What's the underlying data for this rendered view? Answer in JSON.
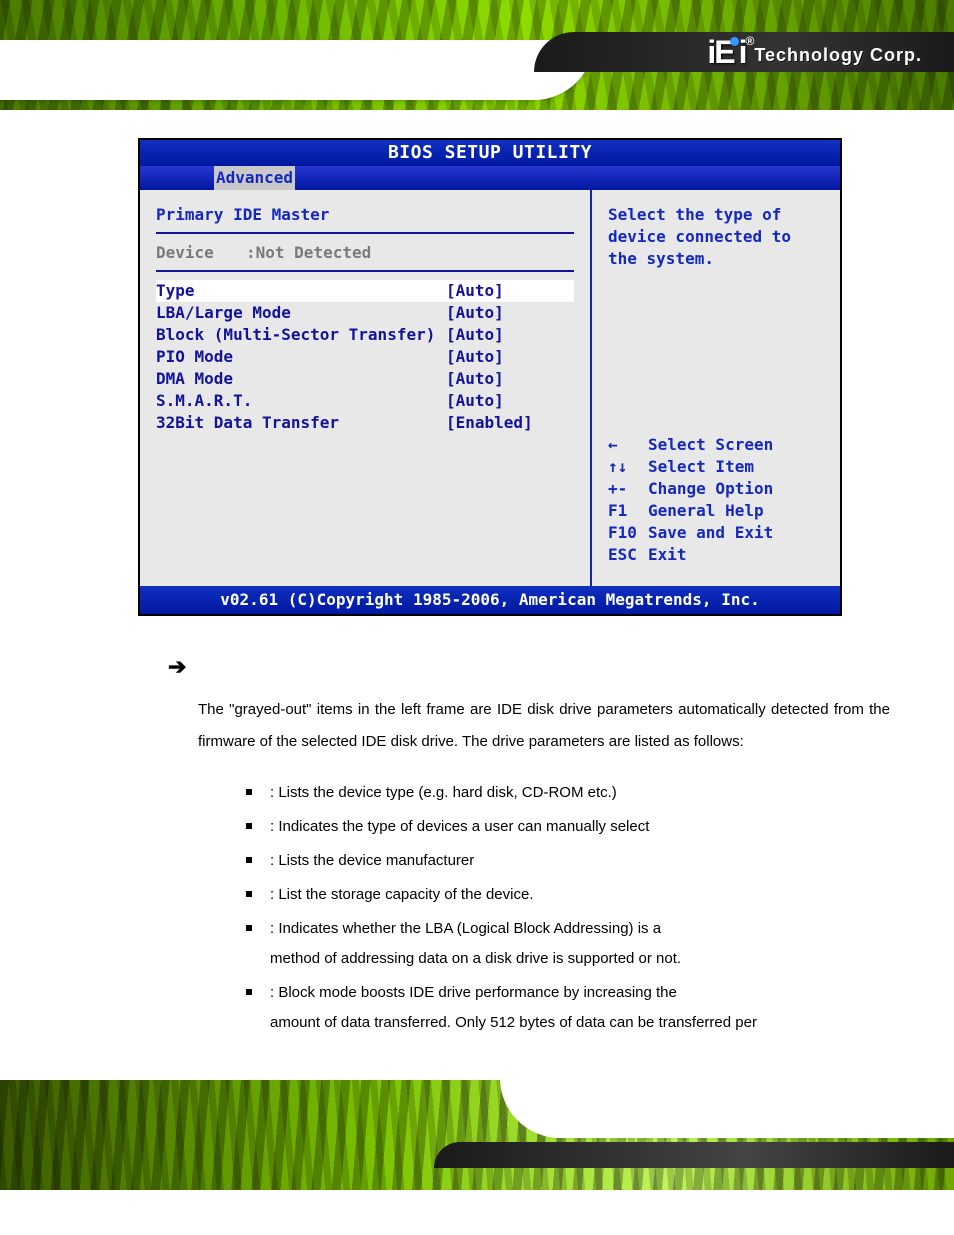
{
  "brand": {
    "name_prefix": "iE",
    "name_suffix": "i",
    "registered": "®",
    "tagline": "Technology Corp."
  },
  "bios": {
    "title": "BIOS SETUP UTILITY",
    "tab": "Advanced",
    "heading": "Primary IDE Master",
    "device_row": {
      "label": "Device",
      "value": ":Not Detected"
    },
    "rows": [
      {
        "label": "Type",
        "value": "[Auto]",
        "selected": true
      },
      {
        "label": "LBA/Large Mode",
        "value": "[Auto]"
      },
      {
        "label": "Block (Multi-Sector Transfer)",
        "value": "[Auto]"
      },
      {
        "label": "PIO Mode",
        "value": "[Auto]"
      },
      {
        "label": "DMA Mode",
        "value": "[Auto]"
      },
      {
        "label": "S.M.A.R.T.",
        "value": "[Auto]"
      },
      {
        "label": "32Bit Data Transfer",
        "value": "[Enabled]"
      }
    ],
    "help_text": "Select the type of device connected to the system.",
    "keys": [
      {
        "k": "←",
        "a": "Select Screen"
      },
      {
        "k": "↑↓",
        "a": "Select Item"
      },
      {
        "k": "+-",
        "a": "Change Option"
      },
      {
        "k": "F1",
        "a": "General Help"
      },
      {
        "k": "F10",
        "a": "Save and Exit"
      },
      {
        "k": "ESC",
        "a": "Exit"
      }
    ],
    "footer": "v02.61 (C)Copyright 1985-2006, American Megatrends, Inc."
  },
  "arrow_glyph": "➔",
  "paragraph": "The \"grayed-out\" items in the left frame are IDE disk drive parameters automatically detected from the firmware of the selected IDE disk drive. The drive parameters are listed as follows:",
  "bullets": [
    {
      "t1": ": Lists the device type (e.g. hard disk, CD-ROM etc.)"
    },
    {
      "t1": ": Indicates the type of devices a user can manually select"
    },
    {
      "t1": ": Lists the device manufacturer"
    },
    {
      "t1": ": List the storage capacity of the device."
    },
    {
      "t1": ": Indicates whether the LBA (Logical Block Addressing) is a",
      "t2": "method of addressing data on a disk drive is supported or not."
    },
    {
      "t1": ": Block mode boosts IDE drive performance by increasing the",
      "t2": "amount of data transferred. Only 512 bytes of data can be transferred per"
    }
  ]
}
